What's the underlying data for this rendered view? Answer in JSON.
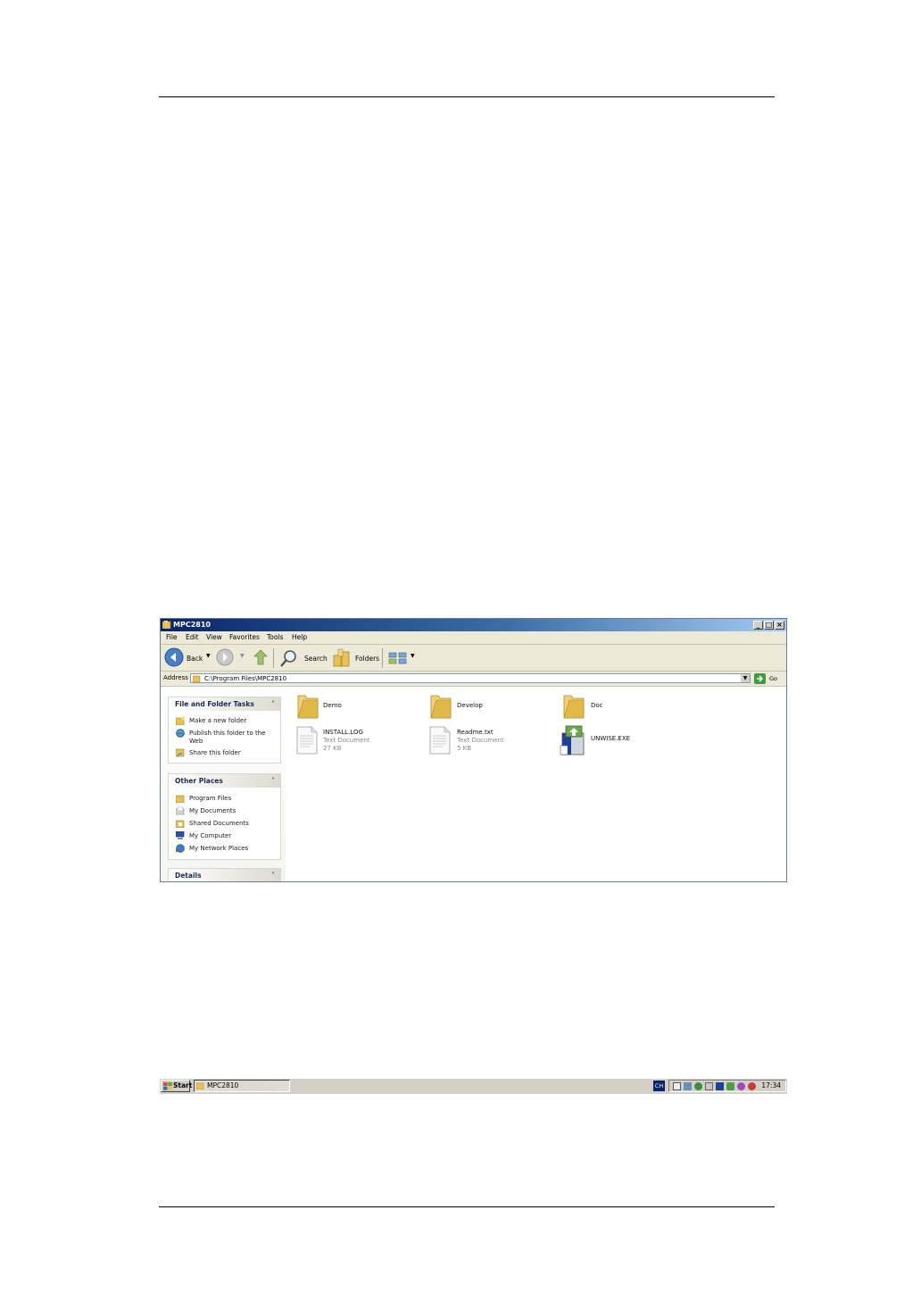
{
  "window": {
    "title": "MPC2810",
    "menu": [
      "File",
      "Edit",
      "View",
      "Favorites",
      "Tools",
      "Help"
    ],
    "toolbar": {
      "back_label": "Back",
      "search_label": "Search",
      "folders_label": "Folders"
    },
    "address": {
      "label": "Address",
      "value": "C:\\Program Files\\MPC2810",
      "go_label": "Go"
    }
  },
  "tasks": {
    "file_folder": {
      "title": "File and Folder Tasks",
      "items": [
        "Make a new folder",
        "Publish this folder to the",
        "Web",
        "Share this folder"
      ]
    },
    "other_places": {
      "title": "Other Places",
      "items": [
        "Program Files",
        "My Documents",
        "Shared Documents",
        "My Computer",
        "My Network Places"
      ]
    },
    "details": {
      "title": "Details"
    }
  },
  "files": [
    {
      "name": "Demo",
      "kind": "folder-icon"
    },
    {
      "name": "Develop",
      "kind": "folder-icon"
    },
    {
      "name": "Doc",
      "kind": "folder-icon"
    },
    {
      "name": "INSTALL.LOG",
      "type": "Text Document",
      "size": "27 KB",
      "kind": "text-document-icon"
    },
    {
      "name": "Readme.txt",
      "type": "Text Document",
      "size": "5 KB",
      "kind": "text-document-icon"
    },
    {
      "name": "UNWISE.EXE",
      "kind": "installer-icon"
    }
  ],
  "taskbar": {
    "start_label": "Start",
    "task_label": "MPC2810",
    "lang": "CH",
    "clock": "17:34"
  },
  "colors": {
    "title_start": "#0a246a",
    "title_end": "#a6caf0",
    "folder": "#e8c158",
    "chrome": "#ece9d8"
  }
}
